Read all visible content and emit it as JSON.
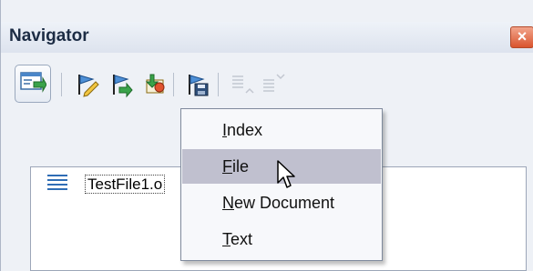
{
  "window": {
    "title": "Navigator",
    "close_symbol": "×"
  },
  "toolbar": {
    "buttons": [
      {
        "icon": "content-view-icon",
        "active": true
      },
      {
        "icon": "edit-pencil-flag-icon"
      },
      {
        "icon": "next-green-flag-icon"
      },
      {
        "icon": "insert-link-icon"
      },
      {
        "icon": "save-flag-icon"
      },
      {
        "icon": "promote-level-icon",
        "disabled": true
      },
      {
        "icon": "demote-level-icon",
        "disabled": true
      }
    ]
  },
  "tree": {
    "items": [
      {
        "label": "TestFile1.o",
        "icon": "document-lines-icon"
      }
    ]
  },
  "menu": {
    "items": [
      {
        "label": "Index",
        "mnemonic": "I",
        "rest": "ndex"
      },
      {
        "label": "File",
        "mnemonic": "F",
        "rest": "ile",
        "hovered": true
      },
      {
        "label": "New Document",
        "mnemonic": "N",
        "rest": "ew Document"
      },
      {
        "label": "Text",
        "mnemonic": "T",
        "rest": "ext"
      }
    ]
  },
  "colors": {
    "background": "#eef1f6",
    "hover": "#c0c0cf",
    "close": "#d9542e"
  }
}
